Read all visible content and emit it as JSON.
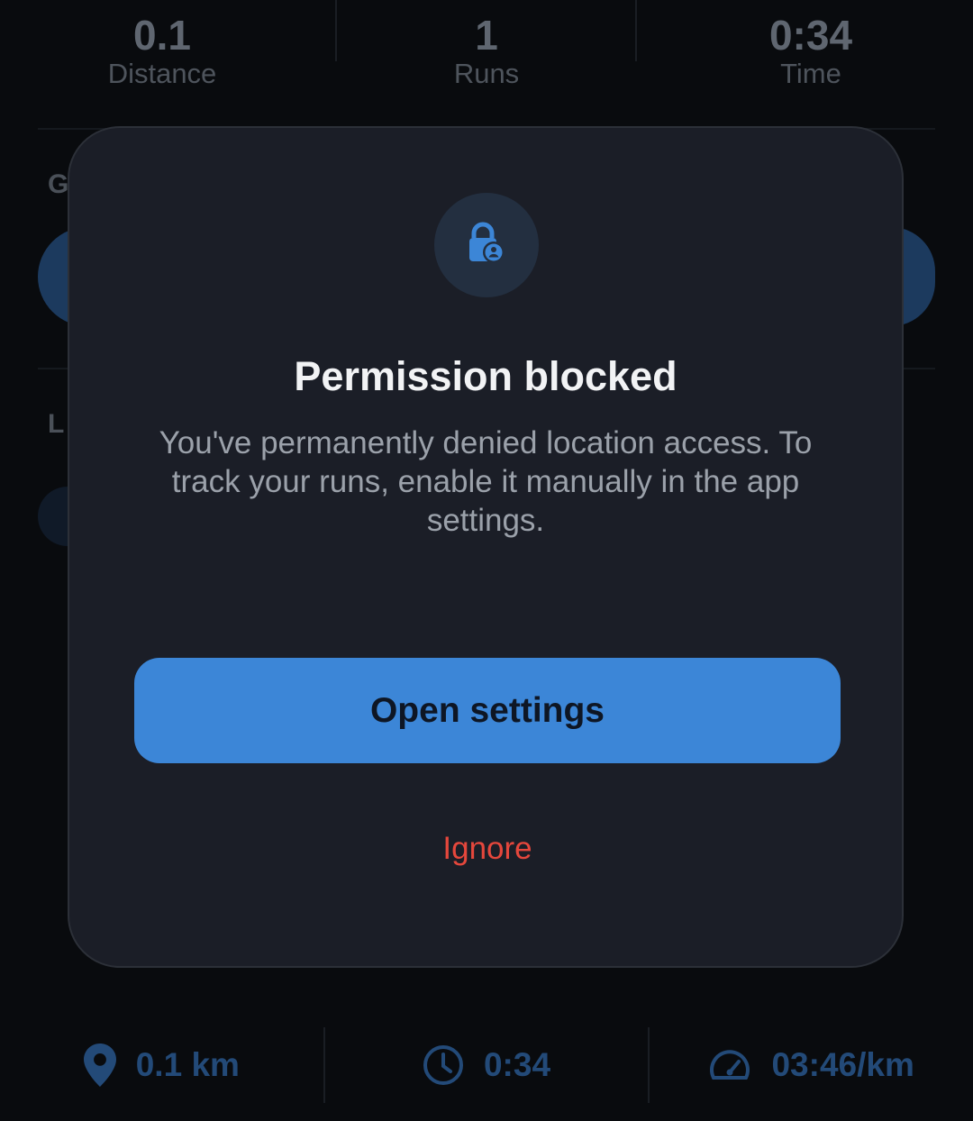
{
  "stats": [
    {
      "value": "0.1",
      "label": "Distance"
    },
    {
      "value": "1",
      "label": "Runs"
    },
    {
      "value": "0:34",
      "label": "Time"
    }
  ],
  "background": {
    "section_letter_1": "G",
    "section_letter_2": "L"
  },
  "bottom_bar": [
    {
      "icon": "location-pin-icon",
      "text": "0.1 km"
    },
    {
      "icon": "clock-icon",
      "text": "0:34"
    },
    {
      "icon": "speedometer-icon",
      "text": "03:46/km"
    }
  ],
  "dialog": {
    "icon": "lock-person-icon",
    "title": "Permission blocked",
    "message": "You've permanently denied location access. To track your runs, enable it manually in the app settings.",
    "primary_label": "Open settings",
    "secondary_label": "Ignore"
  },
  "colors": {
    "accent": "#3c86d7",
    "danger": "#e5473c",
    "dialog_bg": "#1b1e27",
    "page_bg": "#090b0e"
  }
}
